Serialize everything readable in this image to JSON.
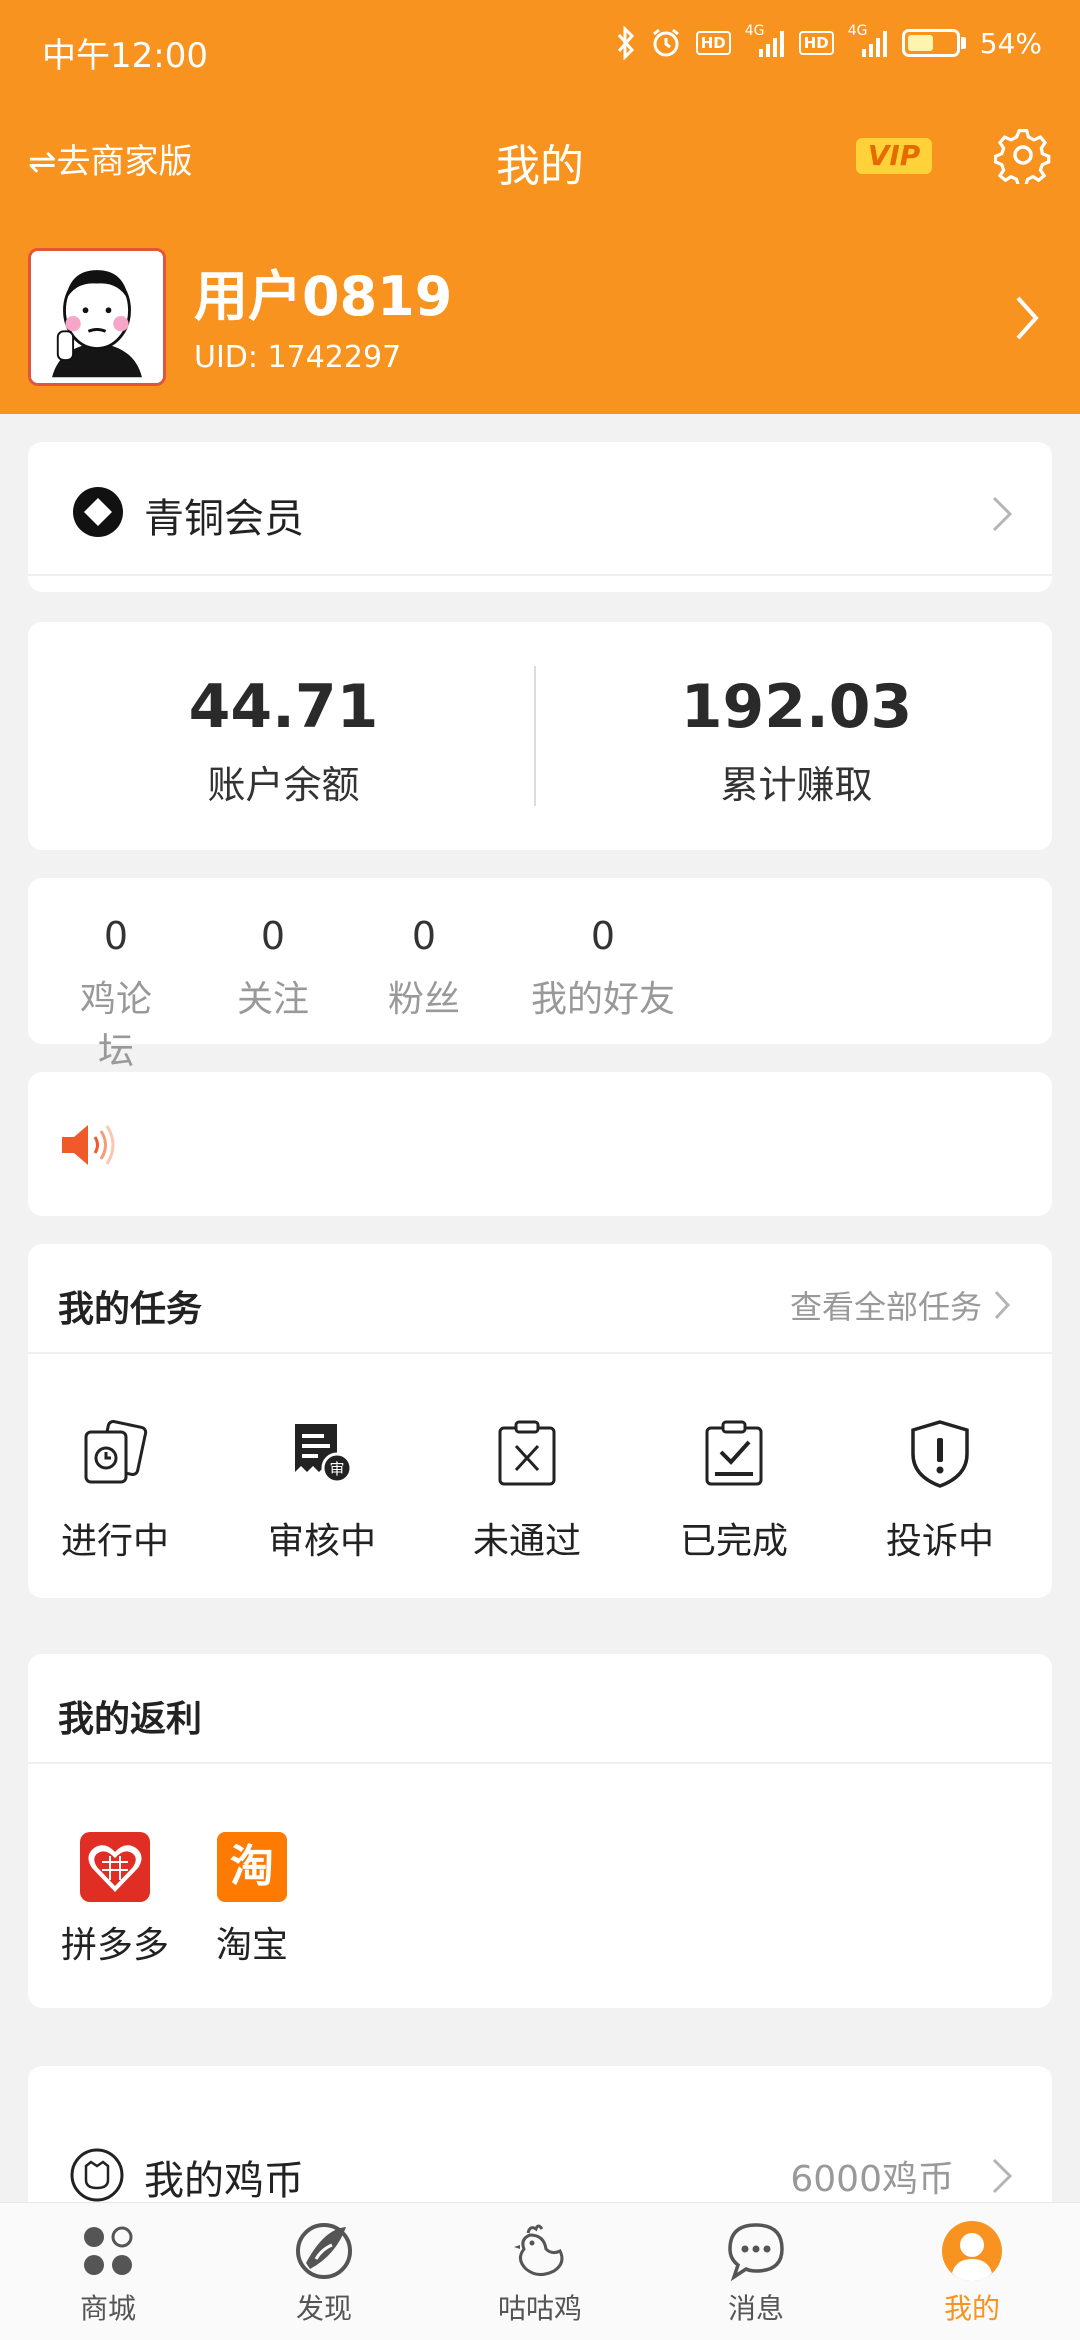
{
  "status_bar": {
    "time": "中午12:00",
    "hd1": "HD",
    "net1": "4G",
    "hd2": "HD",
    "net2": "4G",
    "battery": "54%",
    "battery_level": 0.54
  },
  "header": {
    "merchant_link": "⇌去商家版",
    "title": "我的",
    "vip_label": "VIP"
  },
  "profile": {
    "name": "用户0819",
    "uid": "UID: 1742297"
  },
  "membership": {
    "label": "青铜会员"
  },
  "balance": {
    "items": [
      {
        "value": "44.71",
        "label": "账户余额"
      },
      {
        "value": "192.03",
        "label": "累计赚取"
      }
    ]
  },
  "social": {
    "items": [
      {
        "value": "0",
        "label": "鸡论坛"
      },
      {
        "value": "0",
        "label": "关注"
      },
      {
        "value": "0",
        "label": "粉丝"
      },
      {
        "value": "0",
        "label": "我的好友"
      }
    ]
  },
  "tasks": {
    "title": "我的任务",
    "view_all": "查看全部任务",
    "items": [
      {
        "label": "进行中",
        "icon": "in-progress-icon"
      },
      {
        "label": "审核中",
        "icon": "under-review-icon"
      },
      {
        "label": "未通过",
        "icon": "rejected-icon"
      },
      {
        "label": "已完成",
        "icon": "completed-icon"
      },
      {
        "label": "投诉中",
        "icon": "complaint-icon"
      }
    ]
  },
  "rebates": {
    "title": "我的返利",
    "items": [
      {
        "label": "拼多多",
        "icon": "pinduoduo-icon",
        "color": "#e02e24"
      },
      {
        "label": "淘宝",
        "icon": "taobao-icon",
        "color": "#ff7a00",
        "glyph": "淘"
      }
    ]
  },
  "coins": {
    "label": "我的鸡币",
    "value": "6000鸡币"
  },
  "tabbar": {
    "active_color": "#f7931e",
    "items": [
      {
        "label": "商城",
        "icon": "shop-icon"
      },
      {
        "label": "发现",
        "icon": "discover-icon"
      },
      {
        "label": "咕咕鸡",
        "icon": "chicken-icon"
      },
      {
        "label": "消息",
        "icon": "message-icon"
      },
      {
        "label": "我的",
        "icon": "profile-icon",
        "active": true
      }
    ]
  },
  "colors": {
    "brand": "#f7931e",
    "vip_bg": "#ffd23a",
    "speaker": "#f05a28"
  }
}
